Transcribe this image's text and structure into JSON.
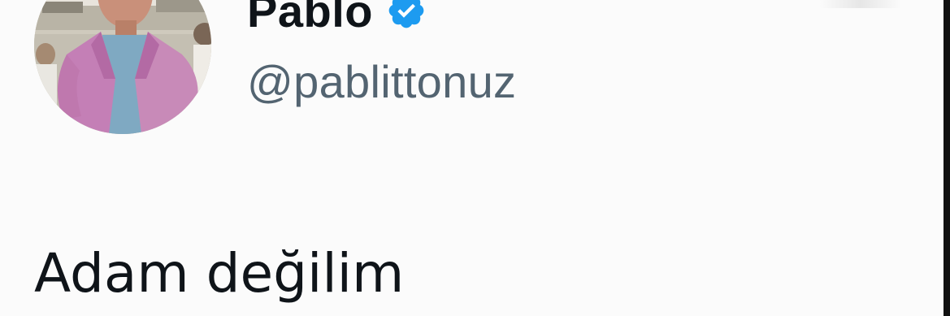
{
  "author": {
    "display_name": "Pablo",
    "handle": "@pablittonuz",
    "verified": true,
    "avatar_icon": "profile-photo-pink-suit"
  },
  "tweet": {
    "text": "Adam değilim"
  },
  "colors": {
    "name": "#0f1419",
    "handle": "#536471",
    "verified_badge": "#1d9bf0",
    "background": "#fbfbfb"
  }
}
